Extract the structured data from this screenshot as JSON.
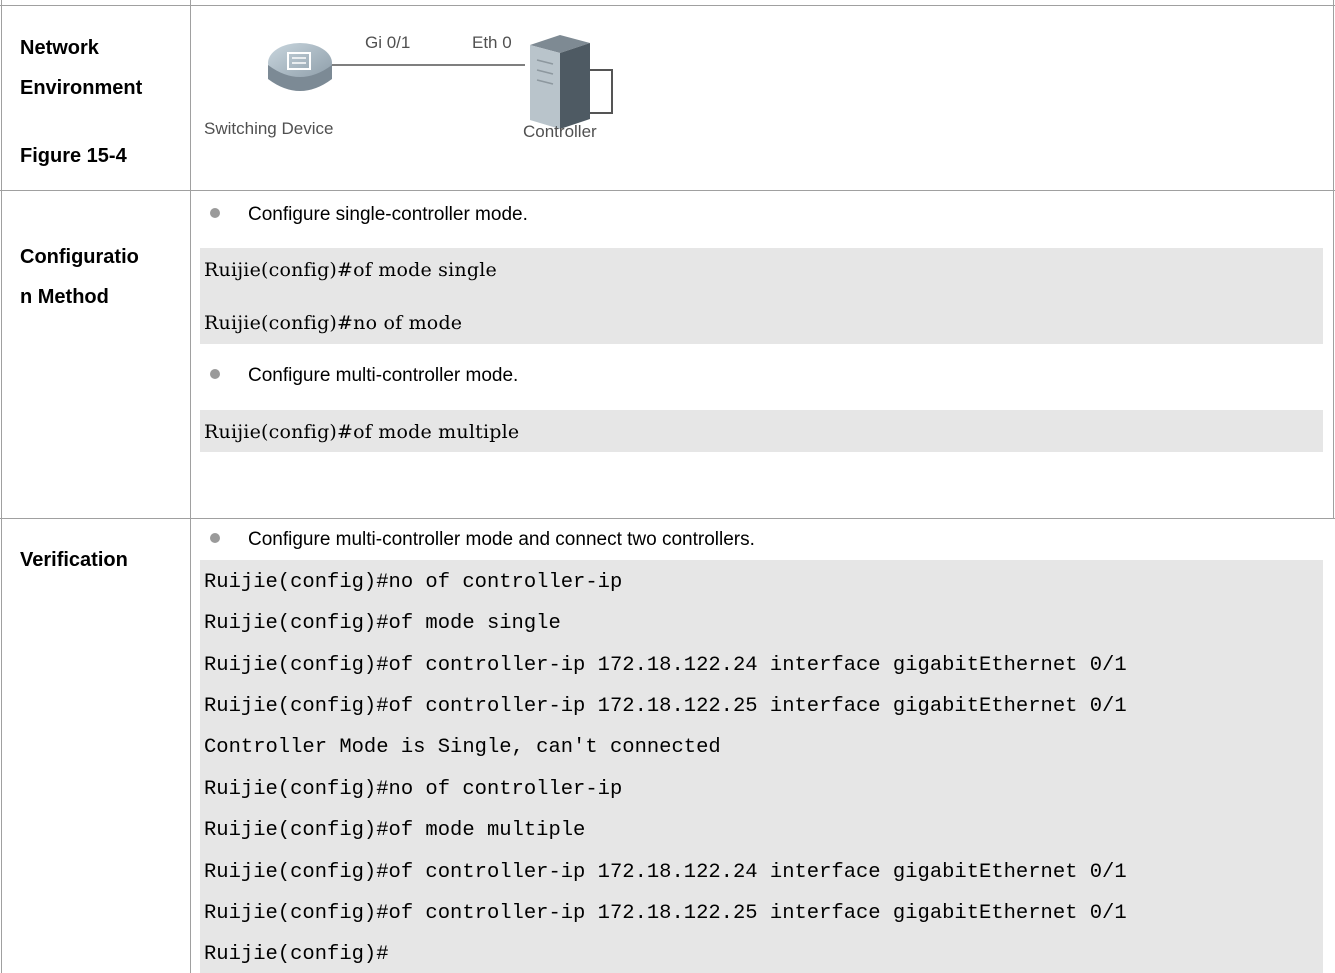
{
  "rows": {
    "network": {
      "header_lines": [
        "Network",
        "Environment",
        "",
        "Figure 15-4"
      ],
      "diagram": {
        "switch_label": "Switching Device",
        "controller_label": "Controller",
        "port_switch": "Gi 0/1",
        "port_controller": "Eth 0"
      }
    },
    "config": {
      "header_lines": [
        "Configuratio",
        "n Method"
      ],
      "bullet1": "Configure single-controller mode.",
      "code1": [
        "Ruijie(config)#of mode single",
        "Ruijie(config)#no of mode"
      ],
      "bullet2": "Configure multi-controller mode.",
      "code2": [
        "Ruijie(config)#of mode multiple"
      ]
    },
    "verification": {
      "header_lines": [
        "Verification"
      ],
      "bullet1": "Configure multi-controller mode and connect two controllers.",
      "code": [
        "Ruijie(config)#no of controller-ip",
        "Ruijie(config)#of mode single",
        "Ruijie(config)#of controller-ip 172.18.122.24 interface gigabitEthernet 0/1",
        "Ruijie(config)#of controller-ip 172.18.122.25 interface gigabitEthernet 0/1",
        "Controller Mode is Single, can't connected",
        "Ruijie(config)#no of controller-ip",
        "Ruijie(config)#of mode multiple",
        "Ruijie(config)#of controller-ip 172.18.122.24 interface gigabitEthernet 0/1",
        "Ruijie(config)#of controller-ip 172.18.122.25 interface gigabitEthernet 0/1",
        "Ruijie(config)#"
      ]
    }
  }
}
